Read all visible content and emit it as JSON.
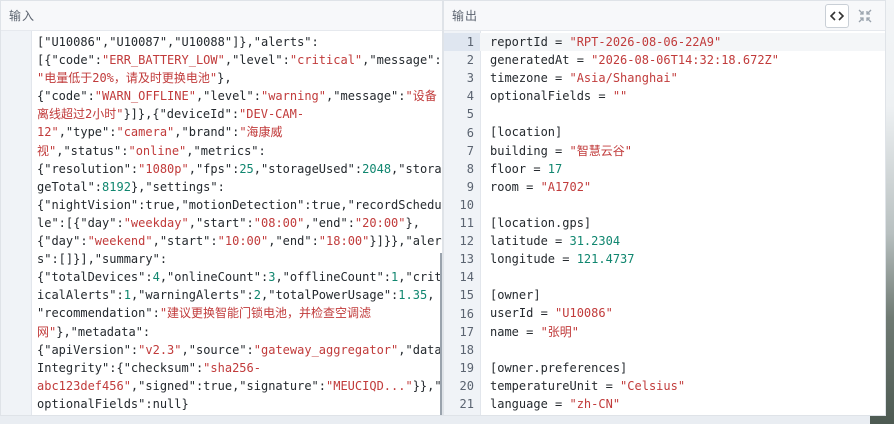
{
  "input_panel": {
    "title": "输入",
    "lines": [
      [
        {
          "t": "k",
          "v": "[\"U10086\",\"U10087\",\"U10088\"]},\"alerts\":"
        }
      ],
      [
        {
          "t": "k",
          "v": "[{\"code\":"
        },
        {
          "t": "s",
          "v": "\"ERR_BATTERY_LOW\""
        },
        {
          "t": "k",
          "v": ",\"level\":"
        },
        {
          "t": "s",
          "v": "\"critical\""
        },
        {
          "t": "k",
          "v": ",\"message\":"
        }
      ],
      [
        {
          "t": "s",
          "v": "\"电量低于20%，请及时更换电池\""
        },
        {
          "t": "k",
          "v": "},"
        }
      ],
      [
        {
          "t": "k",
          "v": "{\"code\":"
        },
        {
          "t": "s",
          "v": "\"WARN_OFFLINE\""
        },
        {
          "t": "k",
          "v": ",\"level\":"
        },
        {
          "t": "s",
          "v": "\"warning\""
        },
        {
          "t": "k",
          "v": ",\"message\":"
        },
        {
          "t": "s",
          "v": "\"设备"
        }
      ],
      [
        {
          "t": "s",
          "v": "离线超过2小时\""
        },
        {
          "t": "k",
          "v": "}]},{\"deviceId\":"
        },
        {
          "t": "s",
          "v": "\"DEV-CAM-"
        }
      ],
      [
        {
          "t": "s",
          "v": "12\""
        },
        {
          "t": "k",
          "v": ",\"type\":"
        },
        {
          "t": "s",
          "v": "\"camera\""
        },
        {
          "t": "k",
          "v": ",\"brand\":"
        },
        {
          "t": "s",
          "v": "\"海康威"
        }
      ],
      [
        {
          "t": "s",
          "v": "视\""
        },
        {
          "t": "k",
          "v": ",\"status\":"
        },
        {
          "t": "s",
          "v": "\"online\""
        },
        {
          "t": "k",
          "v": ",\"metrics\":"
        }
      ],
      [
        {
          "t": "k",
          "v": "{\"resolution\":"
        },
        {
          "t": "s",
          "v": "\"1080p\""
        },
        {
          "t": "k",
          "v": ",\"fps\":"
        },
        {
          "t": "n",
          "v": "25"
        },
        {
          "t": "k",
          "v": ",\"storageUsed\":"
        },
        {
          "t": "n",
          "v": "2048"
        },
        {
          "t": "k",
          "v": ",\"stora"
        }
      ],
      [
        {
          "t": "k",
          "v": "geTotal\":"
        },
        {
          "t": "n",
          "v": "8192"
        },
        {
          "t": "k",
          "v": "},\"settings\":"
        }
      ],
      [
        {
          "t": "k",
          "v": "{\"nightVision\":true,\"motionDetection\":true,\"recordSchedu"
        }
      ],
      [
        {
          "t": "k",
          "v": "le\":[{\"day\":"
        },
        {
          "t": "s",
          "v": "\"weekday\""
        },
        {
          "t": "k",
          "v": ",\"start\":"
        },
        {
          "t": "s",
          "v": "\"08:00\""
        },
        {
          "t": "k",
          "v": ",\"end\":"
        },
        {
          "t": "s",
          "v": "\"20:00\""
        },
        {
          "t": "k",
          "v": "},"
        }
      ],
      [
        {
          "t": "k",
          "v": "{\"day\":"
        },
        {
          "t": "s",
          "v": "\"weekend\""
        },
        {
          "t": "k",
          "v": ",\"start\":"
        },
        {
          "t": "s",
          "v": "\"10:00\""
        },
        {
          "t": "k",
          "v": ",\"end\":"
        },
        {
          "t": "s",
          "v": "\"18:00\""
        },
        {
          "t": "k",
          "v": "}]}},\"alert"
        }
      ],
      [
        {
          "t": "k",
          "v": "s\":[]}],\"summary\":"
        }
      ],
      [
        {
          "t": "k",
          "v": "{\"totalDevices\":"
        },
        {
          "t": "n",
          "v": "4"
        },
        {
          "t": "k",
          "v": ",\"onlineCount\":"
        },
        {
          "t": "n",
          "v": "3"
        },
        {
          "t": "k",
          "v": ",\"offlineCount\":"
        },
        {
          "t": "n",
          "v": "1"
        },
        {
          "t": "k",
          "v": ",\"crit"
        }
      ],
      [
        {
          "t": "k",
          "v": "icalAlerts\":"
        },
        {
          "t": "n",
          "v": "1"
        },
        {
          "t": "k",
          "v": ",\"warningAlerts\":"
        },
        {
          "t": "n",
          "v": "2"
        },
        {
          "t": "k",
          "v": ",\"totalPowerUsage\":"
        },
        {
          "t": "n",
          "v": "1.35"
        },
        {
          "t": "k",
          "v": ","
        }
      ],
      [
        {
          "t": "k",
          "v": "\"recommendation\":"
        },
        {
          "t": "s",
          "v": "\"建议更换智能门锁电池，并检查空调滤"
        }
      ],
      [
        {
          "t": "s",
          "v": "网\""
        },
        {
          "t": "k",
          "v": "},\"metadata\":"
        }
      ],
      [
        {
          "t": "k",
          "v": "{\"apiVersion\":"
        },
        {
          "t": "s",
          "v": "\"v2.3\""
        },
        {
          "t": "k",
          "v": ",\"source\":"
        },
        {
          "t": "s",
          "v": "\"gateway_aggregator\""
        },
        {
          "t": "k",
          "v": ",\"data"
        }
      ],
      [
        {
          "t": "k",
          "v": "Integrity\":{\"checksum\":"
        },
        {
          "t": "s",
          "v": "\"sha256-"
        }
      ],
      [
        {
          "t": "s",
          "v": "abc123def456\""
        },
        {
          "t": "k",
          "v": ",\"signed\":true,\"signature\":"
        },
        {
          "t": "s",
          "v": "\"MEUCIQD...\""
        },
        {
          "t": "k",
          "v": "}},\""
        }
      ],
      [
        {
          "t": "k",
          "v": "optionalFields\":null}"
        }
      ]
    ]
  },
  "output_panel": {
    "title": "输出",
    "buttons": [
      {
        "name": "code-view-icon",
        "glyph": "<>"
      },
      {
        "name": "collapse-icon",
        "glyph": "⤡"
      }
    ],
    "active_line": 1,
    "lines": [
      [
        {
          "t": "k",
          "v": "reportId = "
        },
        {
          "t": "s",
          "v": "\"RPT-2026-08-06-22A9\""
        }
      ],
      [
        {
          "t": "k",
          "v": "generatedAt = "
        },
        {
          "t": "s",
          "v": "\"2026-08-06T14:32:18.672Z\""
        }
      ],
      [
        {
          "t": "k",
          "v": "timezone = "
        },
        {
          "t": "s",
          "v": "\"Asia/Shanghai\""
        }
      ],
      [
        {
          "t": "k",
          "v": "optionalFields = "
        },
        {
          "t": "s",
          "v": "\"\""
        }
      ],
      [
        {
          "t": "k",
          "v": ""
        }
      ],
      [
        {
          "t": "k",
          "v": "[location]"
        }
      ],
      [
        {
          "t": "k",
          "v": "building = "
        },
        {
          "t": "s",
          "v": "\"智慧云谷\""
        }
      ],
      [
        {
          "t": "k",
          "v": "floor = "
        },
        {
          "t": "n",
          "v": "17"
        }
      ],
      [
        {
          "t": "k",
          "v": "room = "
        },
        {
          "t": "s",
          "v": "\"A1702\""
        }
      ],
      [
        {
          "t": "k",
          "v": ""
        }
      ],
      [
        {
          "t": "k",
          "v": "[location.gps]"
        }
      ],
      [
        {
          "t": "k",
          "v": "latitude = "
        },
        {
          "t": "n",
          "v": "31.2304"
        }
      ],
      [
        {
          "t": "k",
          "v": "longitude = "
        },
        {
          "t": "n",
          "v": "121.4737"
        }
      ],
      [
        {
          "t": "k",
          "v": ""
        }
      ],
      [
        {
          "t": "k",
          "v": "[owner]"
        }
      ],
      [
        {
          "t": "k",
          "v": "userId = "
        },
        {
          "t": "s",
          "v": "\"U10086\""
        }
      ],
      [
        {
          "t": "k",
          "v": "name = "
        },
        {
          "t": "s",
          "v": "\"张明\""
        }
      ],
      [
        {
          "t": "k",
          "v": ""
        }
      ],
      [
        {
          "t": "k",
          "v": "[owner.preferences]"
        }
      ],
      [
        {
          "t": "k",
          "v": "temperatureUnit = "
        },
        {
          "t": "s",
          "v": "\"Celsius\""
        }
      ],
      [
        {
          "t": "k",
          "v": "language = "
        },
        {
          "t": "s",
          "v": "\"zh-CN\""
        }
      ]
    ],
    "line_numbers": [
      "1",
      "2",
      "3",
      "4",
      "5",
      "6",
      "7",
      "8",
      "9",
      "10",
      "11",
      "12",
      "13",
      "14",
      "15",
      "16",
      "17",
      "18",
      "19",
      "20",
      "21"
    ]
  }
}
